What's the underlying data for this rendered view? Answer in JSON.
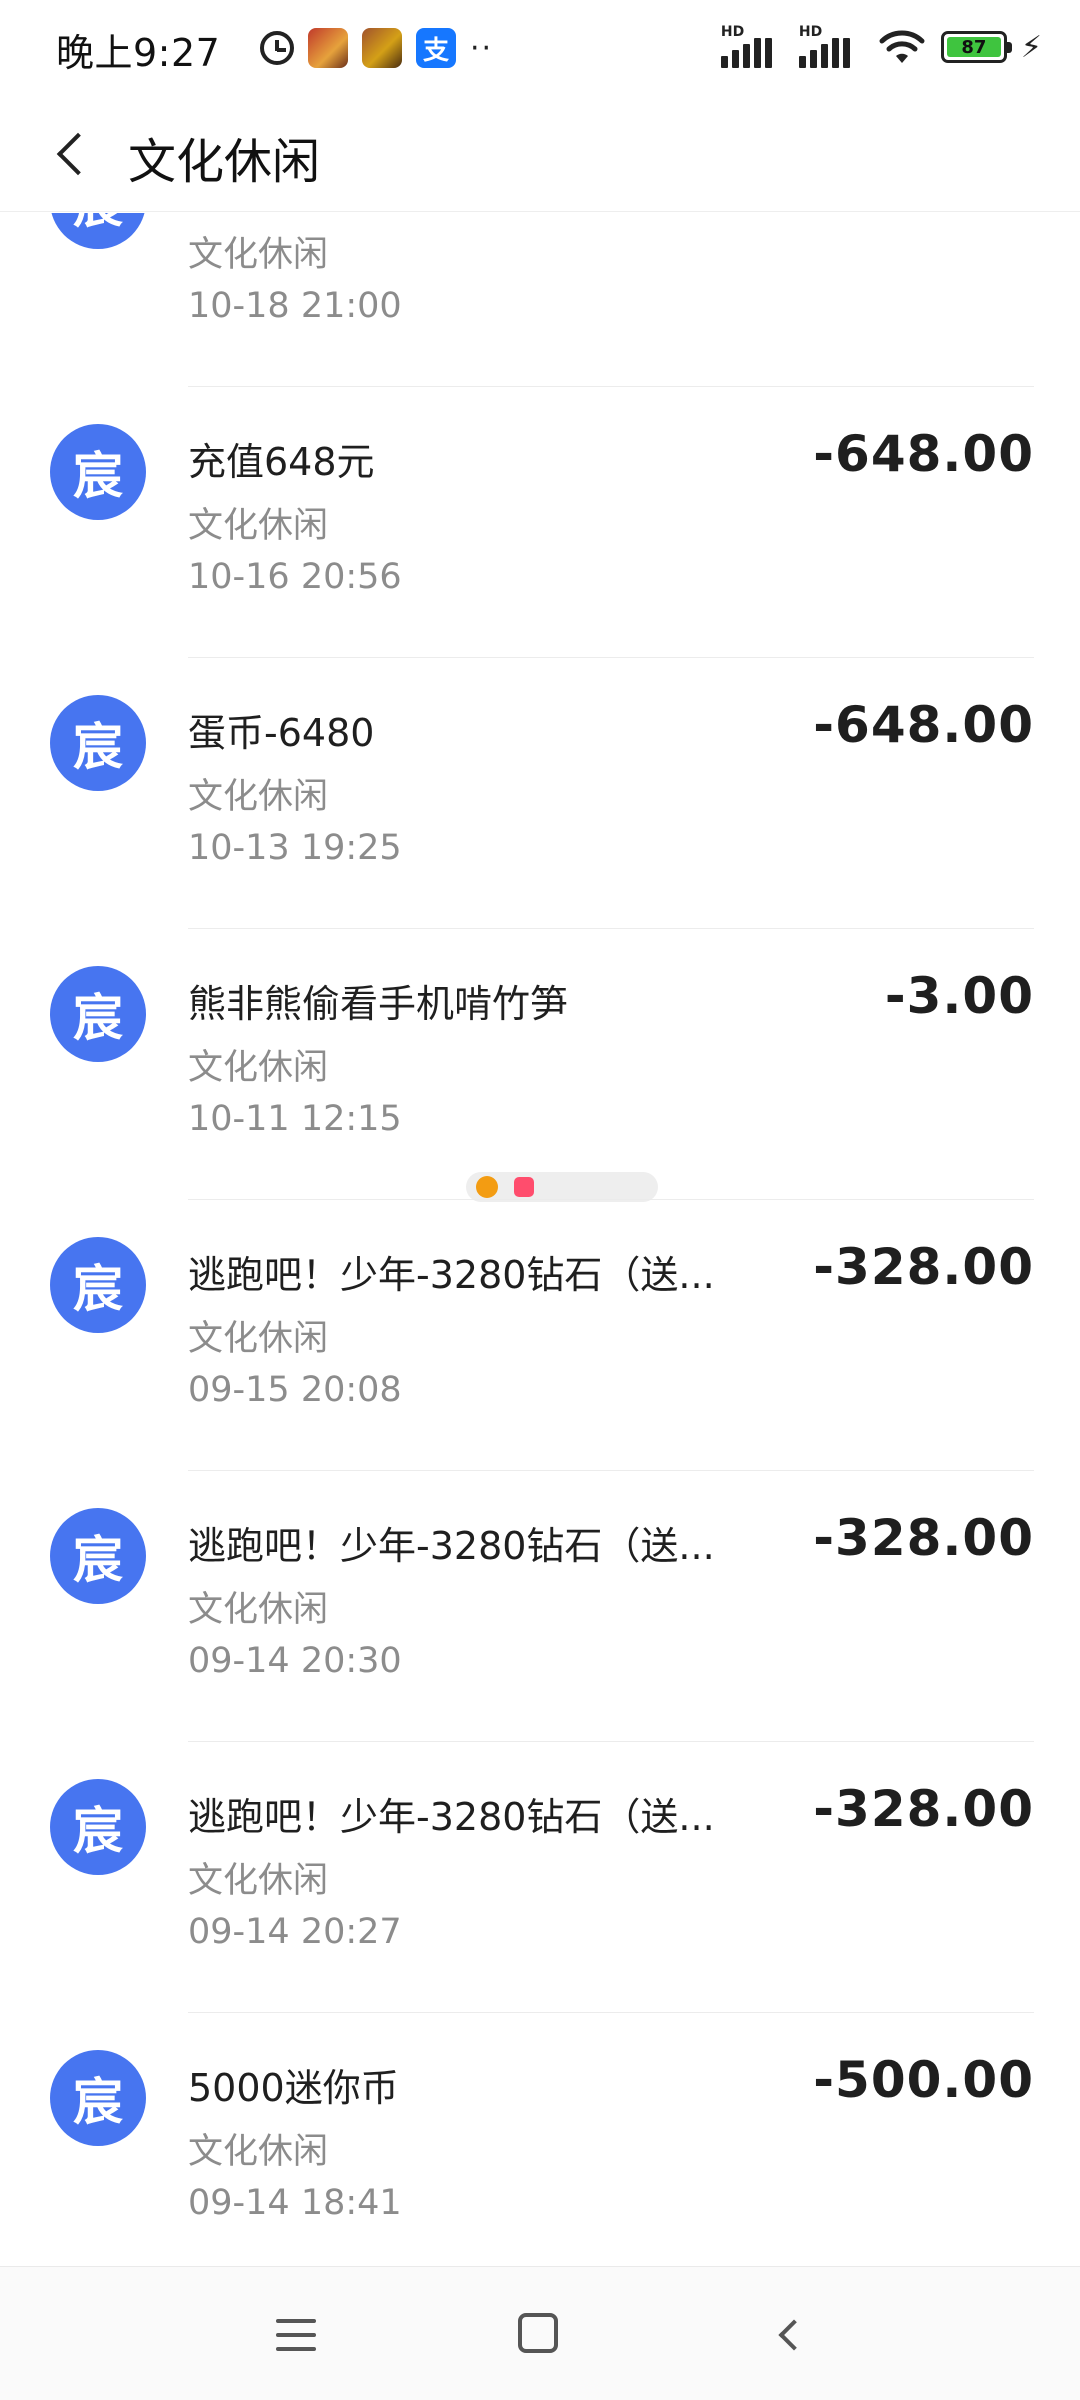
{
  "status_bar": {
    "time": "晚上9:27",
    "app_icon_3_glyph": "支",
    "more_dots": "··",
    "battery_level": "87",
    "signal_1_label": "HD",
    "signal_2_label": "HD",
    "charging_glyph": "⚡"
  },
  "header": {
    "title": "文化休闲",
    "back_icon": "chevron-left-icon"
  },
  "avatar_glyph": "宸",
  "transactions": [
    {
      "title": "",
      "category": "文化休闲",
      "time": "10-18  21:00",
      "amount": ""
    },
    {
      "title": "充值648元",
      "category": "文化休闲",
      "time": "10-16  20:56",
      "amount": "-648.00"
    },
    {
      "title": "蛋币-6480",
      "category": "文化休闲",
      "time": "10-13  19:25",
      "amount": "-648.00"
    },
    {
      "title": "熊非熊偷看手机啃竹笋",
      "category": "文化休闲",
      "time": "10-11  12:15",
      "amount": "-3.00"
    },
    {
      "title": "逃跑吧！少年-3280钻石（送...",
      "category": "文化休闲",
      "time": "09-15  20:08",
      "amount": "-328.00"
    },
    {
      "title": "逃跑吧！少年-3280钻石（送...",
      "category": "文化休闲",
      "time": "09-14  20:30",
      "amount": "-328.00"
    },
    {
      "title": "逃跑吧！少年-3280钻石（送...",
      "category": "文化休闲",
      "time": "09-14  20:27",
      "amount": "-328.00"
    },
    {
      "title": "5000迷你币",
      "category": "文化休闲",
      "time": "09-14  18:41",
      "amount": "-500.00"
    }
  ],
  "watermark": {
    "text_1": "",
    "text_2": ""
  },
  "nav_bar": {
    "menu_icon": "menu-icon",
    "home_icon": "home-icon",
    "back_icon": "back-icon"
  },
  "colors": {
    "avatar_bg": "#4775f0",
    "battery_fill": "#3fc43f",
    "secondary_text": "#8c8c8c"
  }
}
